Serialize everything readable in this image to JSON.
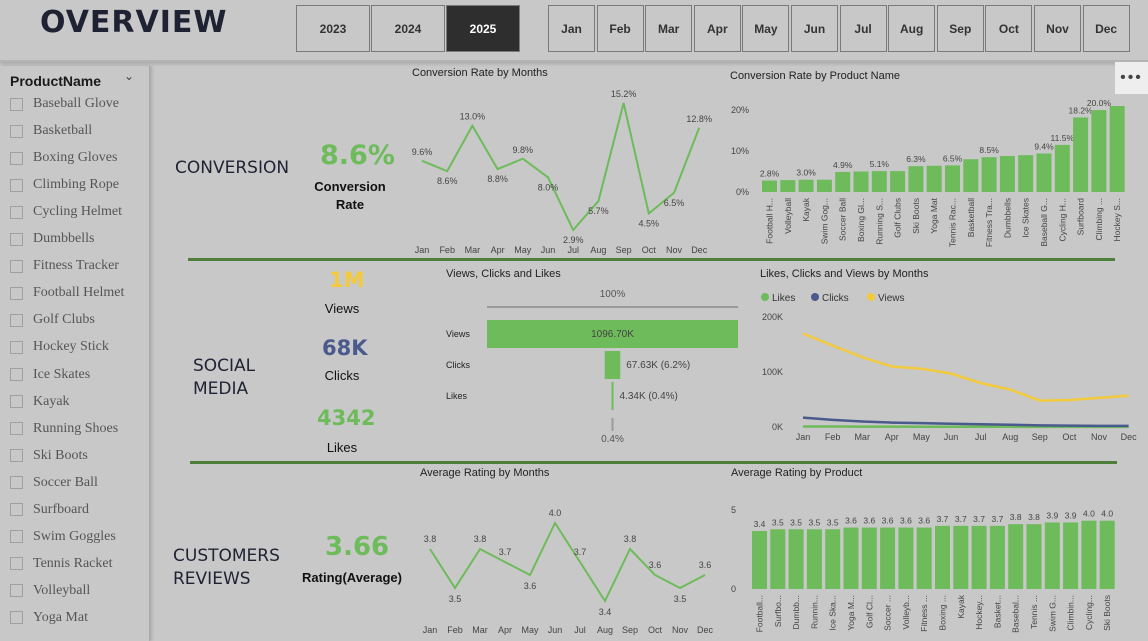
{
  "header": {
    "title": "OVERVIEW",
    "years": [
      "2023",
      "2024",
      "2025"
    ],
    "selected_year": "2025",
    "months": [
      "Jan",
      "Feb",
      "Mar",
      "Apr",
      "May",
      "Jun",
      "Jul",
      "Aug",
      "Sep",
      "Oct",
      "Nov",
      "Dec"
    ]
  },
  "sidebar": {
    "title": "ProductName",
    "items": [
      "Baseball Glove",
      "Basketball",
      "Boxing Gloves",
      "Climbing Rope",
      "Cycling Helmet",
      "Dumbbells",
      "Fitness Tracker",
      "Football Helmet",
      "Golf Clubs",
      "Hockey Stick",
      "Ice Skates",
      "Kayak",
      "Running Shoes",
      "Ski Boots",
      "Soccer Ball",
      "Surfboard",
      "Swim Goggles",
      "Tennis Racket",
      "Volleyball",
      "Yoga Mat"
    ]
  },
  "colors": {
    "green": "#6dbb5a",
    "blue": "#4a5a8c",
    "yellow": "#f2ca3c",
    "divider": "#4e7f3a"
  },
  "conversion": {
    "section": "CONVERSION",
    "value": "8.6%",
    "caption_line1": "Conversion",
    "caption_line2": "Rate"
  },
  "social": {
    "section_line1": "SOCIAL",
    "section_line2": "MEDIA",
    "views_value": "1M",
    "views_label": "Views",
    "clicks_value": "68K",
    "clicks_label": "Clicks",
    "likes_value": "4342",
    "likes_label": "Likes"
  },
  "reviews": {
    "section_line1": "CUSTOMERS",
    "section_line2": "REVIEWS",
    "value": "3.66",
    "caption": "Rating(Average)"
  },
  "more_icon": "ellipsis-icon",
  "chart_data": [
    {
      "id": "conv_months",
      "type": "line",
      "title": "Conversion Rate by Months",
      "categories": [
        "Jan",
        "Feb",
        "Mar",
        "Apr",
        "May",
        "Jun",
        "Jul",
        "Aug",
        "Sep",
        "Oct",
        "Nov",
        "Dec"
      ],
      "values": [
        9.6,
        8.6,
        13.0,
        8.8,
        9.8,
        8.0,
        2.9,
        5.7,
        15.2,
        4.5,
        6.5,
        12.8
      ],
      "labels": [
        "9.6%",
        "8.6%",
        "13.0%",
        "8.8%",
        "9.8%",
        "8.0%",
        "2.9%",
        "5.7%",
        "15.2%",
        "4.5%",
        "6.5%",
        "12.8%"
      ]
    },
    {
      "id": "conv_product",
      "type": "bar",
      "title": "Conversion Rate by Product Name",
      "categories": [
        "Football H...",
        "Volleyball",
        "Kayak",
        "Swim Gog...",
        "Soccer Ball",
        "Boxing Gl...",
        "Running S...",
        "Golf Clubs",
        "Ski Boots",
        "Yoga Mat",
        "Tennis Rac...",
        "Basketball",
        "Fitness Tra...",
        "Dumbbells",
        "Ice Skates",
        "Baseball G...",
        "Cycling H...",
        "Surfboard",
        "Climbing ...",
        "Hockey S..."
      ],
      "values": [
        2.8,
        2.9,
        3.0,
        3.0,
        4.9,
        5.0,
        5.1,
        5.1,
        6.3,
        6.4,
        6.5,
        8.0,
        8.5,
        8.8,
        9.0,
        9.4,
        11.5,
        18.2,
        20.0,
        21.0
      ],
      "labels": [
        "2.8%",
        "",
        "3.0%",
        "",
        "4.9%",
        "",
        "5.1%",
        "",
        "6.3%",
        "",
        "6.5%",
        "",
        "8.5%",
        "",
        "",
        "9.4%",
        "11.5%",
        "18.2%",
        "20.0%",
        ""
      ],
      "yticks": [
        "0%",
        "10%",
        "20%"
      ],
      "ylim": [
        0,
        22
      ]
    },
    {
      "id": "funnel",
      "type": "bar",
      "title": "Views, Clicks and Likes",
      "categories": [
        "Views",
        "Clicks",
        "Likes"
      ],
      "values": [
        1096.7,
        67.63,
        4.34
      ],
      "labels": [
        "1096.70K",
        "67.63K (6.2%)",
        "4.34K (0.4%)"
      ],
      "top_label": "100%",
      "bottom_label": "0.4%"
    },
    {
      "id": "lcv_months",
      "type": "line",
      "title": "Likes, Clicks and Views by Months",
      "categories": [
        "Jan",
        "Feb",
        "Mar",
        "Apr",
        "May",
        "Jun",
        "Jul",
        "Aug",
        "Sep",
        "Oct",
        "Nov",
        "Dec"
      ],
      "series": [
        {
          "name": "Likes",
          "color": "#6dbb5a",
          "values": [
            1000,
            900,
            700,
            600,
            500,
            450,
            400,
            350,
            300,
            300,
            250,
            200
          ]
        },
        {
          "name": "Clicks",
          "color": "#4a5a8c",
          "values": [
            17000,
            13000,
            10000,
            8000,
            7000,
            6000,
            5000,
            4000,
            3000,
            2500,
            2000,
            2000
          ]
        },
        {
          "name": "Views",
          "color": "#f2ca3c",
          "values": [
            170000,
            148000,
            127000,
            110000,
            106000,
            97000,
            80000,
            68000,
            48000,
            49000,
            53000,
            57000
          ]
        }
      ],
      "yticks": [
        "0K",
        "100K",
        "200K"
      ],
      "ylim": [
        0,
        200000
      ]
    },
    {
      "id": "rating_months",
      "type": "line",
      "title": "Average Rating by Months",
      "categories": [
        "Jan",
        "Feb",
        "Mar",
        "Apr",
        "May",
        "Jun",
        "Jul",
        "Aug",
        "Sep",
        "Oct",
        "Nov",
        "Dec"
      ],
      "values": [
        3.8,
        3.5,
        3.8,
        3.7,
        3.6,
        4.0,
        3.7,
        3.4,
        3.8,
        3.6,
        3.5,
        3.6
      ],
      "labels": [
        "3.8",
        "3.5",
        "3.8",
        "3.7",
        "3.6",
        "4.0",
        "3.7",
        "3.4",
        "3.8",
        "3.6",
        "3.5",
        "3.6"
      ]
    },
    {
      "id": "rating_product",
      "type": "bar",
      "title": "Average Rating by Product",
      "categories": [
        "Football...",
        "Surfbo...",
        "Dumbb...",
        "Runnin...",
        "Ice Ska...",
        "Yoga M...",
        "Golf Cl...",
        "Soccer ...",
        "Volleyb...",
        "Fitness ...",
        "Boxing ...",
        "Kayak",
        "Hockey...",
        "Basket...",
        "Basebal...",
        "Tennis ...",
        "Swim G...",
        "Climbin...",
        "Cycling...",
        "Ski Boots"
      ],
      "values": [
        3.4,
        3.5,
        3.5,
        3.5,
        3.5,
        3.6,
        3.6,
        3.6,
        3.6,
        3.6,
        3.7,
        3.7,
        3.7,
        3.7,
        3.8,
        3.8,
        3.9,
        3.9,
        4.0,
        4.0
      ],
      "labels": [
        "3.4",
        "3.5",
        "3.5",
        "3.5",
        "3.5",
        "3.6",
        "3.6",
        "3.6",
        "3.6",
        "3.6",
        "3.7",
        "3.7",
        "3.7",
        "3.7",
        "3.8",
        "3.8",
        "3.9",
        "3.9",
        "4.0",
        "4.0"
      ],
      "yticks": [
        "0",
        "5"
      ],
      "ylim": [
        0,
        5
      ]
    }
  ]
}
